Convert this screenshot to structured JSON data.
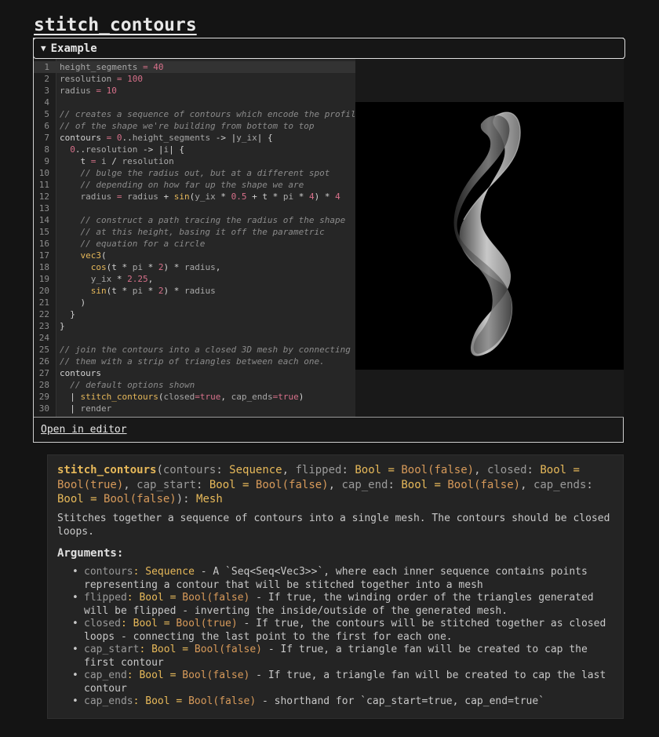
{
  "page": {
    "title": "stitch_contours"
  },
  "example": {
    "summary": "Example",
    "open_in_editor": "Open in editor",
    "lines": [
      {
        "n": "1",
        "tokens": [
          [
            "var",
            "height_segments"
          ],
          [
            "op",
            " = "
          ],
          [
            "num",
            "40"
          ]
        ]
      },
      {
        "n": "2",
        "tokens": [
          [
            "var",
            "resolution"
          ],
          [
            "op",
            " = "
          ],
          [
            "num",
            "100"
          ]
        ]
      },
      {
        "n": "3",
        "tokens": [
          [
            "var",
            "radius"
          ],
          [
            "op",
            " = "
          ],
          [
            "num",
            "10"
          ]
        ]
      },
      {
        "n": "4",
        "tokens": []
      },
      {
        "n": "5",
        "tokens": [
          [
            "cm",
            "// creates a sequence of contours which encode the profile"
          ]
        ]
      },
      {
        "n": "6",
        "tokens": [
          [
            "cm",
            "// of the shape we're building from bottom to top"
          ]
        ]
      },
      {
        "n": "7",
        "tokens": [
          [
            "plain",
            "contours"
          ],
          [
            "op",
            " = "
          ],
          [
            "num",
            "0"
          ],
          [
            "plain",
            ".."
          ],
          [
            "var",
            "height_segments"
          ],
          [
            "plain",
            " -> |"
          ],
          [
            "var",
            "y_ix"
          ],
          [
            "plain",
            "| {"
          ]
        ]
      },
      {
        "n": "8",
        "tokens": [
          [
            "plain",
            "  "
          ],
          [
            "num",
            "0"
          ],
          [
            "plain",
            ".."
          ],
          [
            "var",
            "resolution"
          ],
          [
            "plain",
            " -> |"
          ],
          [
            "var",
            "i"
          ],
          [
            "plain",
            "| {"
          ]
        ]
      },
      {
        "n": "9",
        "tokens": [
          [
            "plain",
            "    t"
          ],
          [
            "op",
            " = "
          ],
          [
            "var",
            "i"
          ],
          [
            "plain",
            " / "
          ],
          [
            "var",
            "resolution"
          ]
        ]
      },
      {
        "n": "10",
        "tokens": [
          [
            "cm",
            "    // bulge the radius out, but at a different spot"
          ]
        ]
      },
      {
        "n": "11",
        "tokens": [
          [
            "cm",
            "    // depending on how far up the shape we are"
          ]
        ]
      },
      {
        "n": "12",
        "tokens": [
          [
            "plain",
            "    "
          ],
          [
            "var",
            "radius"
          ],
          [
            "op",
            " = "
          ],
          [
            "var",
            "radius"
          ],
          [
            "plain",
            " + "
          ],
          [
            "fn",
            "sin"
          ],
          [
            "plain",
            "("
          ],
          [
            "var",
            "y_ix"
          ],
          [
            "plain",
            " * "
          ],
          [
            "num",
            "0.5"
          ],
          [
            "plain",
            " + t * "
          ],
          [
            "var",
            "pi"
          ],
          [
            "plain",
            " * "
          ],
          [
            "num",
            "4"
          ],
          [
            "plain",
            ") * "
          ],
          [
            "num",
            "4"
          ]
        ]
      },
      {
        "n": "13",
        "tokens": []
      },
      {
        "n": "14",
        "tokens": [
          [
            "cm",
            "    // construct a path tracing the radius of the shape"
          ]
        ]
      },
      {
        "n": "15",
        "tokens": [
          [
            "cm",
            "    // at this height, basing it off the parametric"
          ]
        ]
      },
      {
        "n": "16",
        "tokens": [
          [
            "cm",
            "    // equation for a circle"
          ]
        ]
      },
      {
        "n": "17",
        "tokens": [
          [
            "plain",
            "    "
          ],
          [
            "fn",
            "vec3"
          ],
          [
            "plain",
            "("
          ]
        ]
      },
      {
        "n": "18",
        "tokens": [
          [
            "plain",
            "      "
          ],
          [
            "fn",
            "cos"
          ],
          [
            "plain",
            "(t * "
          ],
          [
            "var",
            "pi"
          ],
          [
            "plain",
            " * "
          ],
          [
            "num",
            "2"
          ],
          [
            "plain",
            ") * "
          ],
          [
            "var",
            "radius"
          ],
          [
            "plain",
            ","
          ]
        ]
      },
      {
        "n": "19",
        "tokens": [
          [
            "plain",
            "      "
          ],
          [
            "var",
            "y_ix"
          ],
          [
            "plain",
            " * "
          ],
          [
            "num",
            "2.25"
          ],
          [
            "plain",
            ","
          ]
        ]
      },
      {
        "n": "20",
        "tokens": [
          [
            "plain",
            "      "
          ],
          [
            "fn",
            "sin"
          ],
          [
            "plain",
            "(t * "
          ],
          [
            "var",
            "pi"
          ],
          [
            "plain",
            " * "
          ],
          [
            "num",
            "2"
          ],
          [
            "plain",
            ") * "
          ],
          [
            "var",
            "radius"
          ]
        ]
      },
      {
        "n": "21",
        "tokens": [
          [
            "plain",
            "    )"
          ]
        ]
      },
      {
        "n": "22",
        "tokens": [
          [
            "plain",
            "  }"
          ]
        ]
      },
      {
        "n": "23",
        "tokens": [
          [
            "plain",
            "}"
          ]
        ]
      },
      {
        "n": "24",
        "tokens": []
      },
      {
        "n": "25",
        "tokens": [
          [
            "cm",
            "// join the contours into a closed 3D mesh by connecting"
          ]
        ]
      },
      {
        "n": "26",
        "tokens": [
          [
            "cm",
            "// them with a strip of triangles between each one."
          ]
        ]
      },
      {
        "n": "27",
        "tokens": [
          [
            "plain",
            "contours"
          ]
        ]
      },
      {
        "n": "28",
        "tokens": [
          [
            "cm",
            "  // default options shown"
          ]
        ]
      },
      {
        "n": "29",
        "tokens": [
          [
            "plain",
            "  | "
          ],
          [
            "fn",
            "stitch_contours"
          ],
          [
            "plain",
            "("
          ],
          [
            "var",
            "closed"
          ],
          [
            "op",
            "="
          ],
          [
            "num",
            "true"
          ],
          [
            "plain",
            ", "
          ],
          [
            "var",
            "cap_ends"
          ],
          [
            "op",
            "="
          ],
          [
            "num",
            "true"
          ],
          [
            "plain",
            ")"
          ]
        ]
      },
      {
        "n": "30",
        "tokens": [
          [
            "plain",
            "  | "
          ],
          [
            "var",
            "render"
          ]
        ]
      }
    ]
  },
  "doc": {
    "signature": {
      "name": "stitch_contours",
      "params": [
        {
          "name": "contours",
          "type": "Sequence",
          "default": ""
        },
        {
          "name": "flipped",
          "type": "Bool",
          "default": "Bool(false)"
        },
        {
          "name": "closed",
          "type": "Bool",
          "default": "Bool(true)"
        },
        {
          "name": "cap_start",
          "type": "Bool",
          "default": "Bool(false)"
        },
        {
          "name": "cap_end",
          "type": "Bool",
          "default": "Bool(false)"
        },
        {
          "name": "cap_ends",
          "type": "Bool",
          "default": "Bool(false)"
        }
      ],
      "return_type": "Mesh"
    },
    "description": "Stitches together a sequence of contours into a single mesh.  The contours should be closed loops.",
    "arguments_heading": "Arguments:",
    "arguments": [
      {
        "name": "contours",
        "type": "Sequence",
        "default": "",
        "text": " - A `Seq<Seq<Vec3>>`, where each inner sequence contains points representing a contour that will be stitched together into a mesh"
      },
      {
        "name": "flipped",
        "type": "Bool",
        "default": "Bool(false)",
        "text": " - If true, the winding order of the triangles generated will be flipped - inverting the inside/outside of the generated mesh."
      },
      {
        "name": "closed",
        "type": "Bool",
        "default": "Bool(true)",
        "text": " - If true, the contours will be stitched together as closed loops - connecting the last point to the first for each one."
      },
      {
        "name": "cap_start",
        "type": "Bool",
        "default": "Bool(false)",
        "text": " - If true, a triangle fan will be created to cap the first contour"
      },
      {
        "name": "cap_end",
        "type": "Bool",
        "default": "Bool(false)",
        "text": " - If true, a triangle fan will be created to cap the last contour"
      },
      {
        "name": "cap_ends",
        "type": "Bool",
        "default": "Bool(false)",
        "text": " - shorthand for `cap_start=true, cap_end=true`"
      }
    ]
  }
}
